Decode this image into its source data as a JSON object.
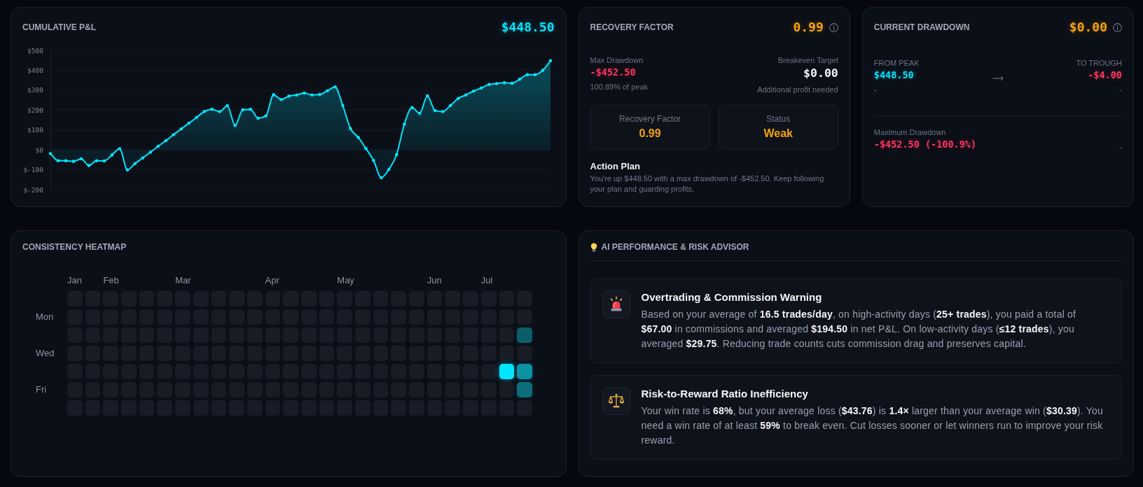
{
  "pnl": {
    "title": "CUMULATIVE P&L",
    "value": "$448.50",
    "chart_data": {
      "type": "area",
      "grid": true,
      "ylim": [
        -200,
        500
      ],
      "yticks": [
        {
          "value": 500,
          "label": "$500"
        },
        {
          "value": 400,
          "label": "$400"
        },
        {
          "value": 300,
          "label": "$300"
        },
        {
          "value": 200,
          "label": "$200"
        },
        {
          "value": 100,
          "label": "$100"
        },
        {
          "value": 0,
          "label": "$0"
        },
        {
          "value": -100,
          "label": "$-100"
        },
        {
          "value": -200,
          "label": "$-200"
        }
      ],
      "values": [
        -19,
        -55,
        -55,
        -58,
        -45,
        -79,
        -55,
        -56,
        -26,
        6,
        -101,
        -69,
        -41,
        -12,
        18,
        46,
        76,
        105,
        134,
        163,
        193,
        204,
        192,
        222,
        123,
        201,
        204,
        159,
        170,
        277,
        253,
        270,
        276,
        285,
        276,
        278,
        297,
        316,
        223,
        107,
        63,
        7,
        -53,
        -140,
        -98,
        -24,
        129,
        212,
        184,
        271,
        197,
        192,
        223,
        258,
        276,
        295,
        311,
        328,
        333,
        337,
        335,
        355,
        378,
        378,
        400,
        448
      ]
    }
  },
  "recovery": {
    "title": "RECOVERY FACTOR",
    "value": "0.99",
    "max_drawdown": {
      "label": "Max Drawdown",
      "value": "-$452.50",
      "note": "100.89% of peak"
    },
    "breakeven": {
      "label": "Breakeven Target",
      "value": "$0.00",
      "note": "Additional profit needed"
    },
    "stats": [
      {
        "label": "Recovery Factor",
        "value": "0.99"
      },
      {
        "label": "Status",
        "value": "Weak"
      }
    ],
    "action_plan": {
      "title": "Action Plan",
      "text": "You're up $448.50 with a max drawdown of -$452.50. Keep following your plan and guarding profits."
    }
  },
  "drawdown": {
    "title": "CURRENT DRAWDOWN",
    "value": "$0.00",
    "from": {
      "label": "FROM PEAK",
      "value": "$448.50",
      "note": "-"
    },
    "to": {
      "label": "TO TROUGH",
      "value": "-$4.00",
      "note": "-"
    },
    "maximum": {
      "label": "Maximum Drawdown",
      "value": "-$452.50 (-100.9%)",
      "note": "-"
    }
  },
  "heatmap": {
    "title": "CONSISTENCY HEATMAP",
    "weekday_labels": [
      "Mon",
      "Wed",
      "Fri"
    ],
    "weeks": [
      {
        "month": "Jan",
        "days": [
          {
            "color": "#171c27"
          },
          {
            "color": "#171c27"
          },
          {
            "color": "#171c27"
          },
          {
            "color": "#171c27"
          },
          {
            "color": "#171c27"
          },
          {
            "color": "#171c27"
          },
          {
            "color": "#171c27"
          }
        ]
      },
      {
        "days": [
          {
            "color": "#171c27"
          },
          {
            "color": "#171c27"
          },
          {
            "color": "#171c27"
          },
          {
            "color": "#171c27"
          },
          {
            "color": "#171c27"
          },
          {
            "color": "#171c27"
          },
          {
            "color": "#171c27"
          }
        ]
      },
      {
        "month": "Feb",
        "days": [
          {
            "color": "#171c27"
          },
          {
            "color": "#171c27"
          },
          {
            "color": "#171c27"
          },
          {
            "color": "#171c27"
          },
          {
            "color": "#171c27"
          },
          {
            "color": "#171c27"
          },
          {
            "color": "#171c27"
          }
        ]
      },
      {
        "days": [
          {
            "color": "#171c27"
          },
          {
            "color": "#171c27"
          },
          {
            "color": "#171c27"
          },
          {
            "color": "#171c27"
          },
          {
            "color": "#171c27"
          },
          {
            "color": "#171c27"
          },
          {
            "color": "#171c27"
          }
        ]
      },
      {
        "days": [
          {
            "color": "#171c27"
          },
          {
            "color": "#171c27"
          },
          {
            "color": "#171c27"
          },
          {
            "color": "#171c27"
          },
          {
            "color": "#171c27"
          },
          {
            "color": "#171c27"
          },
          {
            "color": "#171c27"
          }
        ]
      },
      {
        "days": [
          {
            "color": "#171c27"
          },
          {
            "color": "#171c27"
          },
          {
            "color": "#171c27"
          },
          {
            "color": "#171c27"
          },
          {
            "color": "#171c27"
          },
          {
            "color": "#171c27"
          },
          {
            "color": "#171c27"
          }
        ]
      },
      {
        "month": "Mar",
        "days": [
          {
            "color": "#171c27"
          },
          {
            "color": "#171c27"
          },
          {
            "color": "#171c27"
          },
          {
            "color": "#171c27"
          },
          {
            "color": "#171c27"
          },
          {
            "color": "#171c27"
          },
          {
            "color": "#171c27"
          }
        ]
      },
      {
        "days": [
          {
            "color": "#171c27"
          },
          {
            "color": "#171c27"
          },
          {
            "color": "#171c27"
          },
          {
            "color": "#171c27"
          },
          {
            "color": "#171c27"
          },
          {
            "color": "#171c27"
          },
          {
            "color": "#171c27"
          }
        ]
      },
      {
        "days": [
          {
            "color": "#171c27"
          },
          {
            "color": "#171c27"
          },
          {
            "color": "#171c27"
          },
          {
            "color": "#171c27"
          },
          {
            "color": "#171c27"
          },
          {
            "color": "#171c27"
          },
          {
            "color": "#171c27"
          }
        ]
      },
      {
        "days": [
          {
            "color": "#171c27"
          },
          {
            "color": "#171c27"
          },
          {
            "color": "#171c27"
          },
          {
            "color": "#171c27"
          },
          {
            "color": "#171c27"
          },
          {
            "color": "#171c27"
          },
          {
            "color": "#171c27"
          }
        ]
      },
      {
        "days": [
          {
            "color": "#171c27"
          },
          {
            "color": "#171c27"
          },
          {
            "color": "#171c27"
          },
          {
            "color": "#171c27"
          },
          {
            "color": "#171c27"
          },
          {
            "color": "#171c27"
          },
          {
            "color": "#171c27"
          }
        ]
      },
      {
        "month": "Apr",
        "days": [
          {
            "color": "#171c27"
          },
          {
            "color": "#171c27"
          },
          {
            "color": "#171c27"
          },
          {
            "color": "#171c27"
          },
          {
            "color": "#171c27"
          },
          {
            "color": "#171c27"
          },
          {
            "color": "#171c27"
          }
        ]
      },
      {
        "days": [
          {
            "color": "#171c27"
          },
          {
            "color": "#171c27"
          },
          {
            "color": "#171c27"
          },
          {
            "color": "#171c27"
          },
          {
            "color": "#171c27"
          },
          {
            "color": "#171c27"
          },
          {
            "color": "#171c27"
          }
        ]
      },
      {
        "days": [
          {
            "color": "#171c27"
          },
          {
            "color": "#171c27"
          },
          {
            "color": "#171c27"
          },
          {
            "color": "#171c27"
          },
          {
            "color": "#171c27"
          },
          {
            "color": "#171c27"
          },
          {
            "color": "#171c27"
          }
        ]
      },
      {
        "days": [
          {
            "color": "#171c27"
          },
          {
            "color": "#171c27"
          },
          {
            "color": "#171c27"
          },
          {
            "color": "#171c27"
          },
          {
            "color": "#171c27"
          },
          {
            "color": "#171c27"
          },
          {
            "color": "#171c27"
          }
        ]
      },
      {
        "month": "May",
        "days": [
          {
            "color": "#171c27"
          },
          {
            "color": "#171c27"
          },
          {
            "color": "#171c27"
          },
          {
            "color": "#171c27"
          },
          {
            "color": "#171c27"
          },
          {
            "color": "#171c27"
          },
          {
            "color": "#171c27"
          }
        ]
      },
      {
        "days": [
          {
            "color": "#171c27"
          },
          {
            "color": "#171c27"
          },
          {
            "color": "#171c27"
          },
          {
            "color": "#171c27"
          },
          {
            "color": "#171c27"
          },
          {
            "color": "#171c27"
          },
          {
            "color": "#171c27"
          }
        ]
      },
      {
        "days": [
          {
            "color": "#171c27"
          },
          {
            "color": "#171c27"
          },
          {
            "color": "#171c27"
          },
          {
            "color": "#171c27"
          },
          {
            "color": "#171c27"
          },
          {
            "color": "#171c27"
          },
          {
            "color": "#171c27"
          }
        ]
      },
      {
        "days": [
          {
            "color": "#171c27"
          },
          {
            "color": "#171c27"
          },
          {
            "color": "#171c27"
          },
          {
            "color": "#171c27"
          },
          {
            "color": "#171c27"
          },
          {
            "color": "#171c27"
          },
          {
            "color": "#171c27"
          }
        ]
      },
      {
        "days": [
          {
            "color": "#171c27"
          },
          {
            "color": "#171c27"
          },
          {
            "color": "#171c27"
          },
          {
            "color": "#171c27"
          },
          {
            "color": "#171c27"
          },
          {
            "color": "#171c27"
          },
          {
            "color": "#171c27"
          }
        ]
      },
      {
        "month": "Jun",
        "days": [
          {
            "color": "#171c27"
          },
          {
            "color": "#171c27"
          },
          {
            "color": "#171c27"
          },
          {
            "color": "#171c27"
          },
          {
            "color": "#171c27"
          },
          {
            "color": "#171c27"
          },
          {
            "color": "#171c27"
          }
        ]
      },
      {
        "days": [
          {
            "color": "#171c27"
          },
          {
            "color": "#171c27"
          },
          {
            "color": "#171c27"
          },
          {
            "color": "#171c27"
          },
          {
            "color": "#171c27"
          },
          {
            "color": "#171c27"
          },
          {
            "color": "#171c27"
          }
        ]
      },
      {
        "days": [
          {
            "color": "#171c27"
          },
          {
            "color": "#171c27"
          },
          {
            "color": "#171c27"
          },
          {
            "color": "#171c27"
          },
          {
            "color": "#171c27"
          },
          {
            "color": "#171c27"
          },
          {
            "color": "#171c27"
          }
        ]
      },
      {
        "month": "Jul",
        "days": [
          {
            "color": "#171c27"
          },
          {
            "color": "#171c27"
          },
          {
            "color": "#171c27"
          },
          {
            "color": "#171c27"
          },
          {
            "color": "#171c27"
          },
          {
            "color": "#171c27"
          },
          {
            "color": "#171c27"
          }
        ]
      },
      {
        "days": [
          {
            "color": "#171c27"
          },
          {
            "color": "#171c27"
          },
          {
            "color": "#171c27"
          },
          {
            "color": "#171c27"
          },
          {
            "color": "#00e5ff"
          },
          {
            "color": "#171c27"
          },
          {
            "color": "#171c27"
          }
        ]
      },
      {
        "days": [
          {
            "color": "#171c27"
          },
          {
            "color": "#171c27"
          },
          {
            "color": "#0b5f6a"
          },
          {
            "color": "#171c27"
          },
          {
            "color": "#0993a3"
          },
          {
            "color": "#0b6e7a"
          },
          {
            "color": "#171c27"
          }
        ]
      }
    ]
  },
  "advisor": {
    "title": "AI PERFORMANCE & RISK ADVISOR",
    "insights": [
      {
        "kind": "alert",
        "title": "Overtrading & Commission Warning",
        "text": "Based on your average of **16.5 trades/day**, on high-activity days (**25+ trades**), you paid a total of **$67.00** in commissions and averaged **$194.50** in net P&L. On low-activity days (**≤12 trades**), you averaged **$29.75**. Reducing trade counts cuts commission drag and preserves capital."
      },
      {
        "kind": "balance",
        "title": "Risk-to-Reward Ratio Inefficiency",
        "text": "Your win rate is **68%**, but your average loss (**$43.76**) is **1.4×** larger than your average win (**$30.39**). You need a win rate of at least **59%** to break even. Cut losses sooner or let winners run to improve your risk reward."
      }
    ]
  }
}
